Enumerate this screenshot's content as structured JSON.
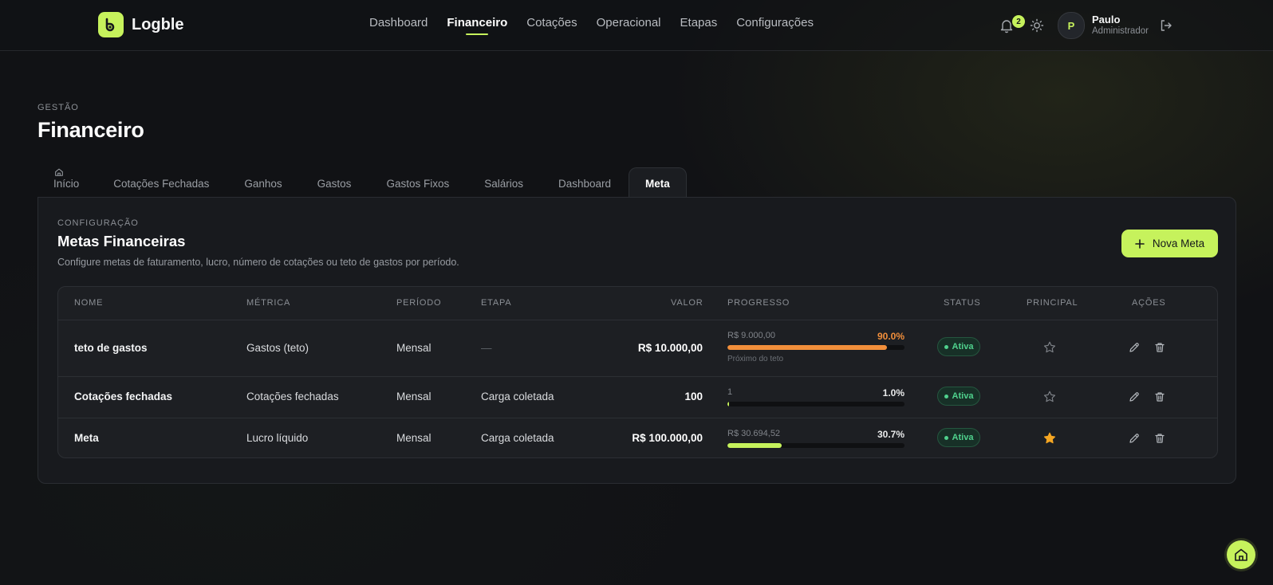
{
  "brand": {
    "name": "Logble",
    "accent": "#c6f25c"
  },
  "nav": [
    "Dashboard",
    "Financeiro",
    "Cotações",
    "Operacional",
    "Etapas",
    "Configurações"
  ],
  "notifications": {
    "count": "2"
  },
  "user": {
    "initial": "P",
    "name": "Paulo",
    "role": "Administrador"
  },
  "page": {
    "eyebrow": "GESTÃO",
    "title": "Financeiro"
  },
  "tabs": [
    "Início",
    "Cotações Fechadas",
    "Ganhos",
    "Gastos",
    "Gastos Fixos",
    "Salários",
    "Dashboard",
    "Meta"
  ],
  "section": {
    "eyebrow": "CONFIGURAÇÃO",
    "title": "Metas Financeiras",
    "description": "Configure metas de faturamento, lucro, número de cotações ou teto de gastos por período.",
    "new_button": "Nova Meta"
  },
  "table": {
    "headers": [
      "NOME",
      "MÉTRICA",
      "PERÍODO",
      "ETAPA",
      "VALOR",
      "PROGRESSO",
      "STATUS",
      "PRINCIPAL",
      "AÇÕES"
    ],
    "rows": [
      {
        "name": "teto de gastos",
        "metric": "Gastos (teto)",
        "period": "Mensal",
        "stage": "—",
        "value": "R$ 10.000,00",
        "progress_current": "R$ 9.000,00",
        "progress_pct": "90.0%",
        "progress": 0.9,
        "progress_note": "Próximo do teto",
        "progress_color": "#f28f3b",
        "status": "Ativa",
        "principal": false
      },
      {
        "name": "Cotações fechadas",
        "metric": "Cotações fechadas",
        "period": "Mensal",
        "stage": "Carga coletada",
        "value": "100",
        "progress_current": "1",
        "progress_pct": "1.0%",
        "progress": 0.01,
        "progress_note": "",
        "progress_color": "#c6f25c",
        "status": "Ativa",
        "principal": false
      },
      {
        "name": "Meta",
        "metric": "Lucro líquido",
        "period": "Mensal",
        "stage": "Carga coletada",
        "value": "R$ 100.000,00",
        "progress_current": "R$ 30.694,52",
        "progress_pct": "30.7%",
        "progress": 0.307,
        "progress_note": "",
        "progress_color": "#c6f25c",
        "status": "Ativa",
        "principal": true
      }
    ]
  },
  "icons": {
    "home": "home-icon",
    "bell": "bell-icon",
    "theme": "sun-icon",
    "logout": "logout-icon",
    "add": "plus-icon",
    "edit": "pencil-icon",
    "delete": "trash-icon",
    "principal": "star-icon"
  }
}
